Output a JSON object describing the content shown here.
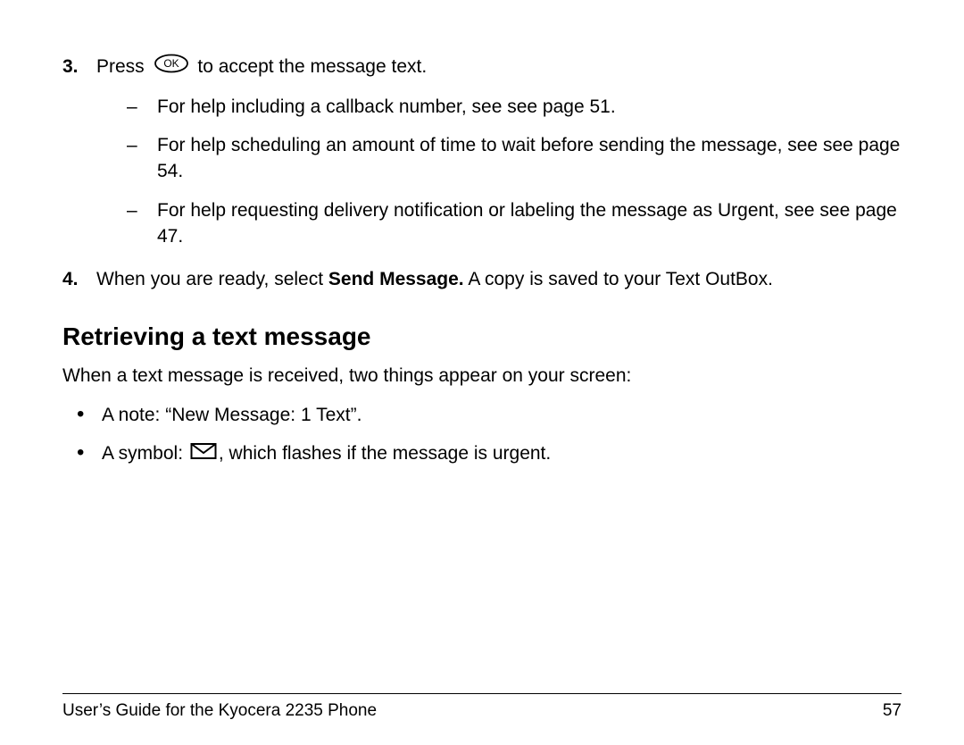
{
  "step3": {
    "num": "3.",
    "before": "Press",
    "after": " to accept the message text.",
    "sub": [
      "For help including a callback number, see see page 51.",
      "For help scheduling an amount of time to wait before sending the message, see see page 54.",
      "For help requesting delivery notification or labeling the message as Urgent, see see page 47."
    ]
  },
  "step4": {
    "num": "4.",
    "before": "When you are ready, select ",
    "bold": "Send Message.",
    "after": " A copy is saved to your Text OutBox."
  },
  "heading": "Retrieving a text message",
  "intro": "When a text message is received, two things appear on your screen:",
  "bullets": {
    "b1": "A note: “New Message: 1 Text”.",
    "b2_before": "A symbol: ",
    "b2_after": ", which flashes if the message is urgent."
  },
  "footer": {
    "title": "User’s Guide for the Kyocera 2235 Phone",
    "page": "57"
  }
}
